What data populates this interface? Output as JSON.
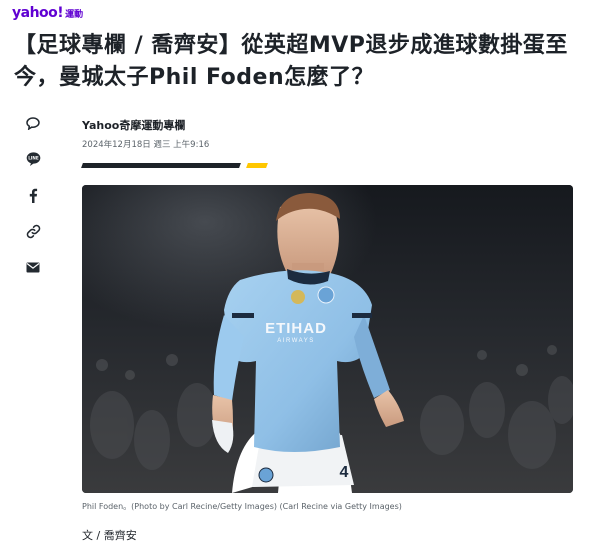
{
  "brand": {
    "logo": "yahoo!",
    "section": "運動"
  },
  "article": {
    "headline": "【足球專欄 / 喬齊安】從英超MVP退步成進球數掛蛋至今，曼城太子Phil Foden怎麼了？",
    "author": "Yahoo奇摩運動專欄",
    "date": "2024年12月18日 週三 上午9:16",
    "caption": "Phil Foden。(Photo by Carl Recine/Getty Images) (Carl Recine via Getty Images)",
    "credit": "文 / 喬齊安"
  },
  "jersey": {
    "sponsor": "ETIHAD",
    "sponsor_sub": "AIRWAYS",
    "number": "4"
  },
  "share": [
    {
      "name": "comment-icon"
    },
    {
      "name": "line-icon"
    },
    {
      "name": "facebook-icon"
    },
    {
      "name": "link-icon"
    },
    {
      "name": "email-icon"
    }
  ],
  "colors": {
    "brand": "#6001d2",
    "text": "#1d2228",
    "muted": "#5b636a",
    "accent": "#ffc700",
    "jersey": "#8fbfe6"
  }
}
